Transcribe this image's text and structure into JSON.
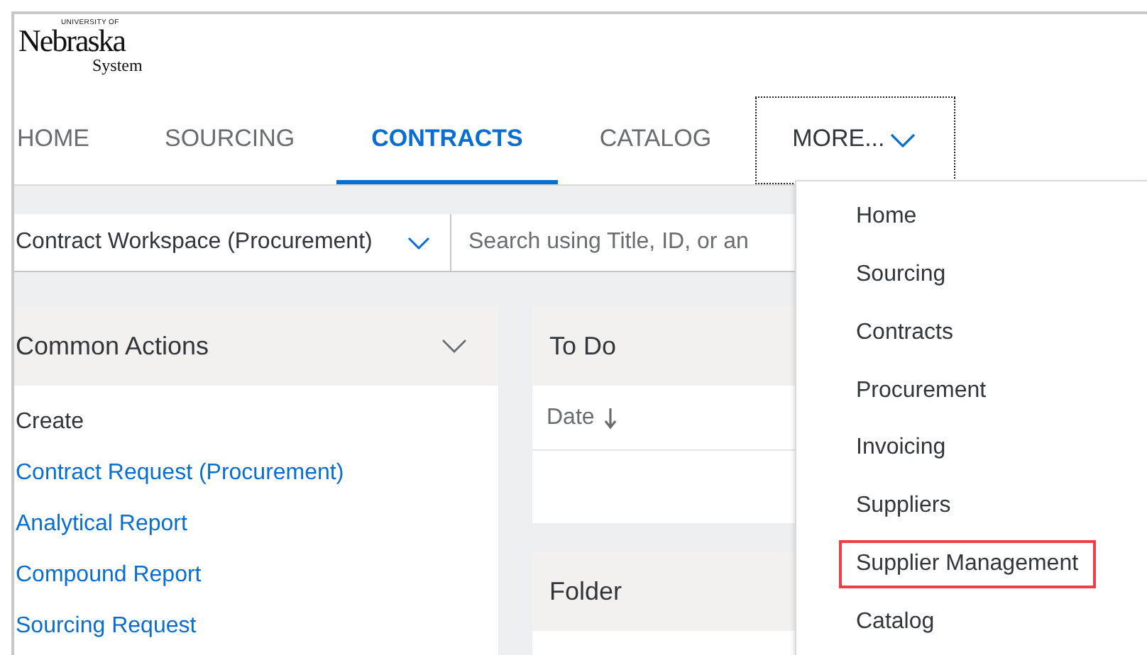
{
  "logo": {
    "top": "UNIVERSITY OF",
    "name": "Nebraska",
    "sub": "System"
  },
  "tabs": [
    {
      "label": "HOME",
      "selected": false,
      "kind": "tab",
      "focused": false
    },
    {
      "label": "SOURCING",
      "selected": false,
      "kind": "tab",
      "focused": false
    },
    {
      "label": "CONTRACTS",
      "selected": true,
      "kind": "tab",
      "focused": false
    },
    {
      "label": "CATALOG",
      "selected": false,
      "kind": "tab",
      "focused": false
    },
    {
      "label": "MORE...",
      "selected": false,
      "kind": "menu",
      "focused": true
    }
  ],
  "filter": {
    "scope": "Contract Workspace (Procurement)",
    "placeholder": "Search using Title, ID, or an"
  },
  "common_actions": {
    "title": "Common Actions",
    "items": [
      {
        "label": "Create",
        "kind": "heading"
      },
      {
        "label": "Contract Request (Procurement)",
        "kind": "link"
      },
      {
        "label": "Analytical Report",
        "kind": "link"
      },
      {
        "label": "Compound Report",
        "kind": "link"
      },
      {
        "label": "Sourcing Request",
        "kind": "link"
      }
    ]
  },
  "todo": {
    "title": "To Do",
    "column": {
      "label": "Date",
      "sort_descending": true
    }
  },
  "folder": {
    "title": "Folder"
  },
  "more_menu": {
    "items": [
      {
        "label": "Home",
        "highlighted": false
      },
      {
        "label": "Sourcing",
        "highlighted": false
      },
      {
        "label": "Contracts",
        "highlighted": false
      },
      {
        "label": "Procurement",
        "highlighted": false
      },
      {
        "label": "Invoicing",
        "highlighted": false
      },
      {
        "label": "Suppliers",
        "highlighted": false
      },
      {
        "label": "Supplier Management",
        "highlighted": true
      },
      {
        "label": "Catalog",
        "highlighted": false
      }
    ]
  }
}
